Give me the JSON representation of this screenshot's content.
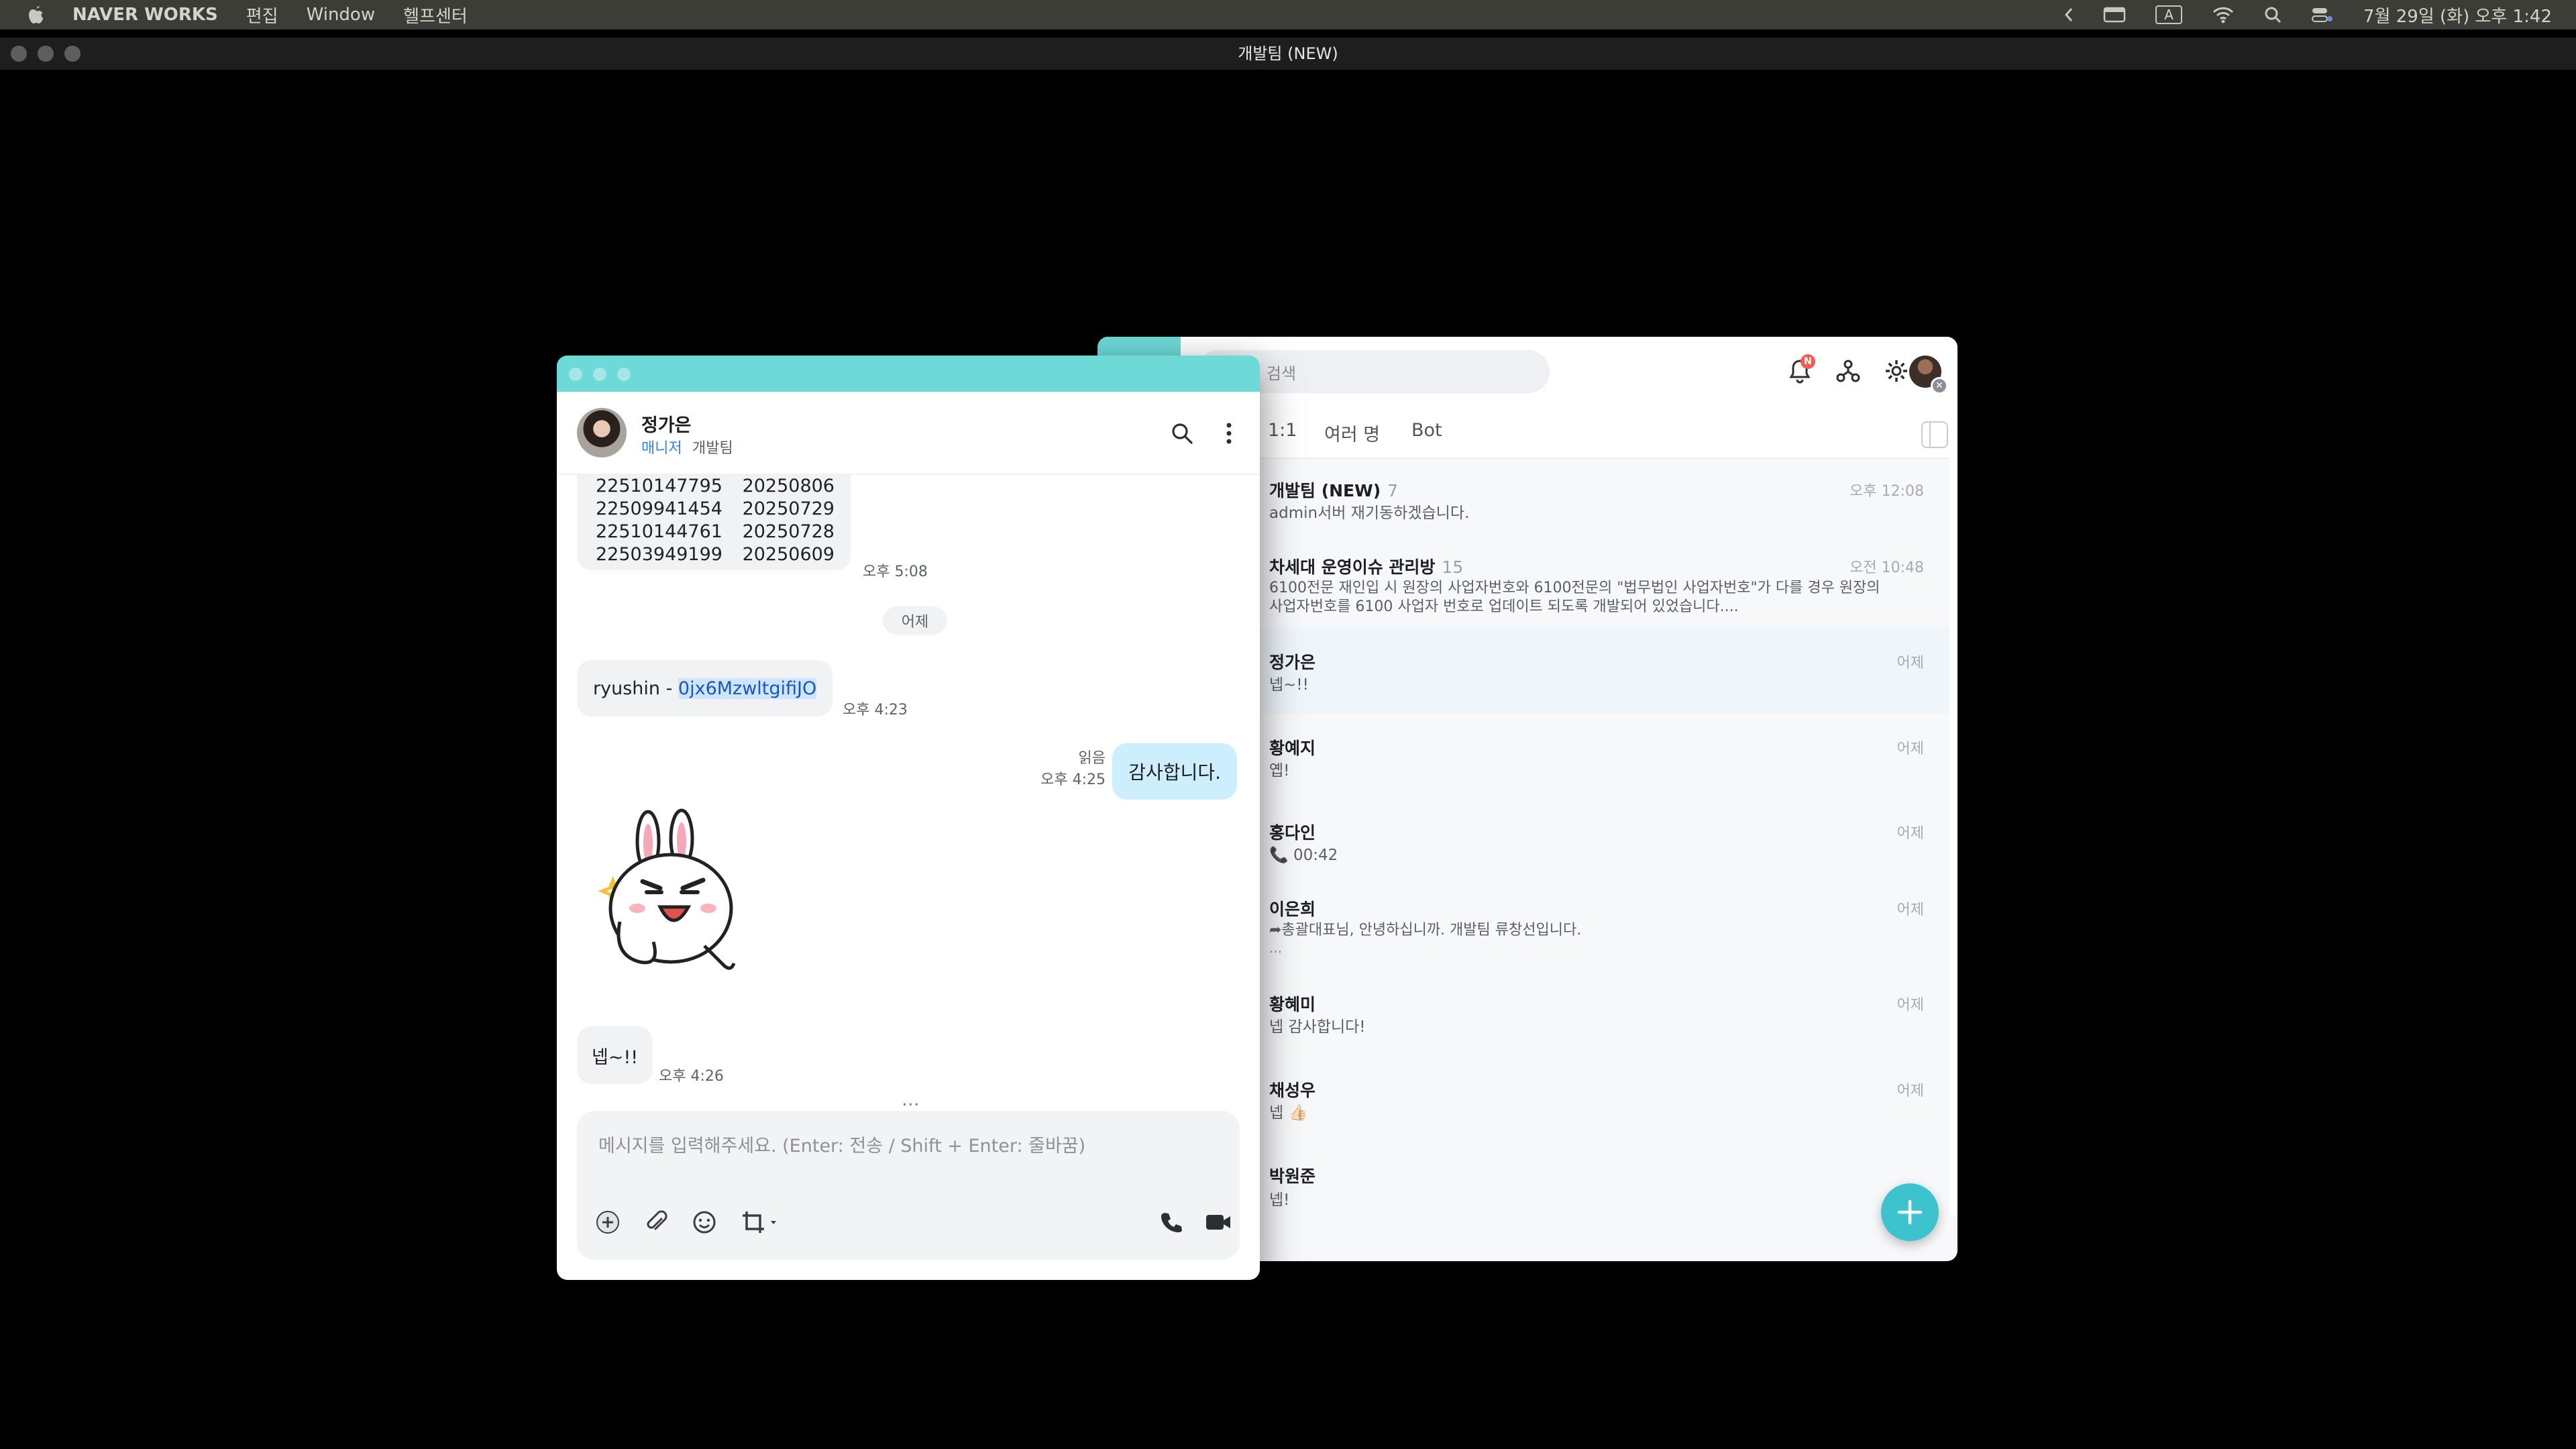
{
  "menubar": {
    "app_name": "NAVER WORKS",
    "items": [
      "편집",
      "Window",
      "헬프센터"
    ],
    "clock": "7월 29일 (화) 오후 1:42",
    "input_source": "A"
  },
  "window": {
    "title": "개발팀 (NEW)"
  },
  "list": {
    "search_placeholder": "메시지 검색",
    "notification_badge": "N",
    "tabs": [
      "1:1",
      "여러 명",
      "Bot"
    ],
    "rooms": [
      {
        "name": "개발팀 (NEW)",
        "count": "7",
        "time": "오후 12:08",
        "lines": [
          "admin서버 재기동하겠습니다."
        ]
      },
      {
        "name": "차세대 운영이슈 관리방",
        "count": "15",
        "time": "오전 10:48",
        "lines": [
          "6100전문 재인입 시 원장의 사업자번호와 6100전문의 \"법무법인 사업자번호\"가 다를 경우 원장의",
          "사업자번호를 6100 사업자 번호로 업데이트 되도록 개발되어 있었습니다...."
        ]
      },
      {
        "name": "정가은",
        "count": "",
        "time": "어제",
        "lines": [
          "넵~!!"
        ]
      },
      {
        "name": "황예지",
        "count": "",
        "time": "어제",
        "lines": [
          "옙!"
        ]
      },
      {
        "name": "홍다인",
        "count": "",
        "time": "어제",
        "lines": [
          "📞 00:42"
        ]
      },
      {
        "name": "이은희",
        "count": "",
        "time": "어제",
        "lines": [
          "➦총괄대표님, 안녕하십니까. 개발팀 류창선입니다.",
          "  ..."
        ]
      },
      {
        "name": "황혜미",
        "count": "",
        "time": "어제",
        "lines": [
          "넵 감사합니다!"
        ]
      },
      {
        "name": "채성우",
        "count": "",
        "time": "어제",
        "lines": [
          "넵 👍🏻"
        ]
      },
      {
        "name": "박원준",
        "count": "",
        "time": "",
        "lines": [
          "넵!"
        ]
      }
    ]
  },
  "chat": {
    "contact_name": "정가은",
    "contact_role": "매니저",
    "contact_team": "개발팀",
    "table_rows": [
      [
        "22510147795",
        "20250806"
      ],
      [
        "22509941454",
        "20250729"
      ],
      [
        "22510144761",
        "20250728"
      ],
      [
        "22503949199",
        "20250609"
      ]
    ],
    "table_time": "오후 5:08",
    "date_divider": "어제",
    "msg1_prefix": "ryushin - ",
    "msg1_highlight": "0jx6MzwltgifiJO",
    "msg1_time": "오후 4:23",
    "sent_text": "감사합니다.",
    "sent_read": "읽음",
    "sent_time": "오후 4:25",
    "reply_text": "넵~!!",
    "reply_time": "오후 4:26",
    "typing_dots": "...",
    "input_placeholder": "메시지를 입력해주세요. (Enter: 전송 / Shift + Enter: 줄바꿈)"
  }
}
